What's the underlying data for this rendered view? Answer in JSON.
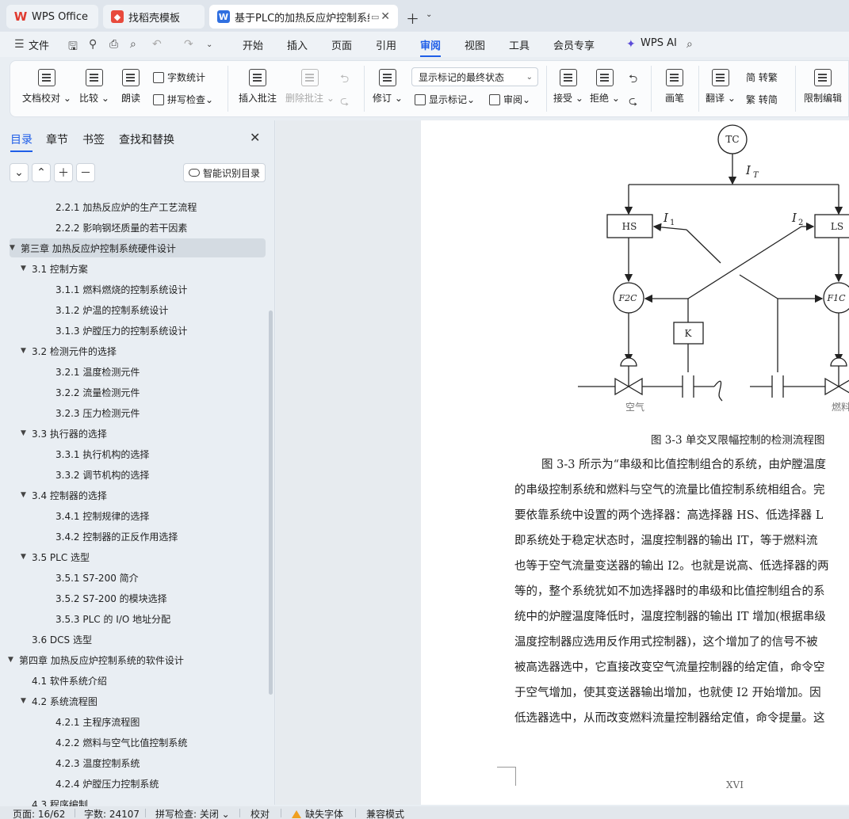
{
  "tabs": [
    {
      "label": "WPS Office"
    },
    {
      "label": "找稻壳模板"
    },
    {
      "label": "基于PLC的加热反应炉控制系统"
    }
  ],
  "menu": {
    "file": "文件",
    "items": [
      "开始",
      "插入",
      "页面",
      "引用",
      "审阅",
      "视图",
      "工具",
      "会员专享"
    ],
    "active": "审阅",
    "ai": "WPS AI"
  },
  "ribbon": {
    "doc_check": "文档校对",
    "compare": "比较",
    "read_aloud": "朗读",
    "word_count": "字数统计",
    "spell_check": "拼写检查",
    "insert_comment": "插入批注",
    "delete_comment": "删除批注",
    "revise": "修订",
    "markup_state": "显示标记的最终状态",
    "show_markup": "显示标记",
    "review_pane": "审阅",
    "accept": "接受",
    "reject": "拒绝",
    "pen": "画笔",
    "translate": "翻译",
    "to_traditional": "简 转繁",
    "to_simplified": "繁 转简",
    "restrict_edit": "限制编辑"
  },
  "sidebar": {
    "tabs": [
      "目录",
      "章节",
      "书签",
      "查找和替换"
    ],
    "smart_toc": "智能识别目录",
    "toc": [
      {
        "label": "2.2.1  加热反应炉的生产工艺流程",
        "level": 3
      },
      {
        "label": "2.2.2  影响钢坯质量的若干因素",
        "level": 3
      },
      {
        "label": "第三章  加热反应炉控制系统硬件设计",
        "level": 1,
        "expanded": true,
        "selected": true
      },
      {
        "label": "3.1  控制方案",
        "level": 2,
        "expanded": true
      },
      {
        "label": "3.1.1  燃料燃烧的控制系统设计",
        "level": 3
      },
      {
        "label": "3.1.2  炉温的控制系统设计",
        "level": 3
      },
      {
        "label": "3.1.3  炉膛压力的控制系统设计",
        "level": 3
      },
      {
        "label": "3.2  检测元件的选择",
        "level": 2,
        "expanded": true
      },
      {
        "label": "3.2.1  温度检测元件",
        "level": 3
      },
      {
        "label": "3.2.2  流量检测元件",
        "level": 3
      },
      {
        "label": "3.2.3  压力检测元件",
        "level": 3
      },
      {
        "label": "3.3  执行器的选择",
        "level": 2,
        "expanded": true
      },
      {
        "label": "3.3.1  执行机构的选择",
        "level": 3
      },
      {
        "label": "3.3.2  调节机构的选择",
        "level": 3
      },
      {
        "label": "3.4  控制器的选择",
        "level": 2,
        "expanded": true
      },
      {
        "label": "3.4.1  控制规律的选择",
        "level": 3
      },
      {
        "label": "3.4.2  控制器的正反作用选择",
        "level": 3
      },
      {
        "label": "3.5 PLC 选型",
        "level": 2,
        "expanded": true
      },
      {
        "label": "3.5.1 S7-200 简介",
        "level": 3
      },
      {
        "label": "3.5.2 S7-200 的模块选择",
        "level": 3
      },
      {
        "label": "3.5.3 PLC 的 I/O 地址分配",
        "level": 3
      },
      {
        "label": "3.6 DCS 选型",
        "level": 2
      },
      {
        "label": "第四章  加热反应炉控制系统的软件设计",
        "level": 1,
        "expanded": true
      },
      {
        "label": "4.1  软件系统介绍",
        "level": 2
      },
      {
        "label": "4.2  系统流程图",
        "level": 2,
        "expanded": true
      },
      {
        "label": "4.2.1  主程序流程图",
        "level": 3
      },
      {
        "label": "4.2.2  燃料与空气比值控制系统",
        "level": 3
      },
      {
        "label": "4.2.3  温度控制系统",
        "level": 3
      },
      {
        "label": "4.2.4  炉膛压力控制系统",
        "level": 3
      },
      {
        "label": "4.3  程序编制",
        "level": 2
      }
    ]
  },
  "document": {
    "diagram": {
      "tc": "TC",
      "it": "I",
      "it_sub": "T",
      "hs": "HS",
      "ls": "LS",
      "i1": "I",
      "i1_sub": "1",
      "i2": "I",
      "i2_sub": "2",
      "f2c": "F2C",
      "f1c": "F1C",
      "k": "K",
      "air": "空气",
      "fuel": "燃料"
    },
    "caption": "图 3-3 单交叉限幅控制的检测流程图",
    "body": [
      "图 3-3 所示为“串级和比值控制组合的系统，由炉膛温度",
      "的串级控制系统和燃料与空气的流量比值控制系统相组合。完",
      "要依靠系统中设置的两个选择器：高选择器 HS、低选择器 L",
      "即系统处于稳定状态时，温度控制器的输出 IT，等于燃料流",
      "也等于空气流量变送器的输出 I2。也就是说高、低选择器的两",
      "等的，整个系统犹如不加选择器时的串级和比值控制组合的系",
      "统中的炉膛温度降低时，温度控制器的输出 IT 增加(根据串级",
      "温度控制器应选用反作用式控制器)，这个增加了的信号不被",
      "被高选器选中，它直接改变空气流量控制器的给定值，命令空",
      "于空气增加，使其变送器输出增加，也就使 I2 开始增加。因",
      "低选器选中，从而改变燃料流量控制器给定值，命令提量。这"
    ],
    "page_number": "XVI"
  },
  "status": {
    "page": "页面: 16/62",
    "words": "字数: 24107",
    "spell": "拼写检查: 关闭",
    "proof": "校对",
    "missing_font": "缺失字体",
    "compat": "兼容模式"
  }
}
